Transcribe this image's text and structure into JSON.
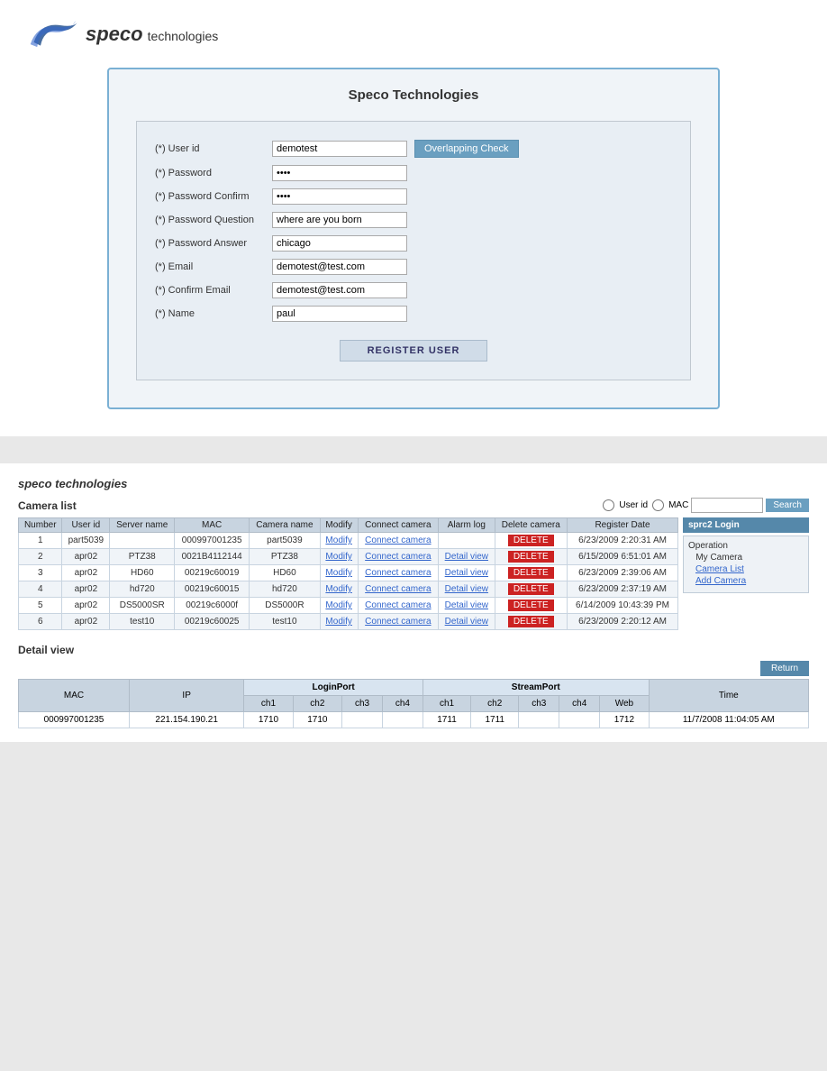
{
  "page": {
    "background": "#e8e8e8"
  },
  "top": {
    "logo": {
      "brand": "speco",
      "suffix": "technologies"
    },
    "form": {
      "title": "Speco Technologies",
      "fields": {
        "user_id_label": "(*) User id",
        "user_id_value": "demotest",
        "password_label": "(*) Password",
        "password_confirm_label": "(*) Password Confirm",
        "password_question_label": "(*) Password Question",
        "password_question_value": "where are you born",
        "password_answer_label": "(*) Password Answer",
        "password_answer_value": "chicago",
        "email_label": "(*) Email",
        "email_value": "demotest@test.com",
        "confirm_email_label": "(*) Confirm Email",
        "confirm_email_value": "demotest@test.com",
        "name_label": "(*) Name",
        "name_value": "paul"
      },
      "overlap_btn": "Overlapping Check",
      "register_btn": "REGISTER USER"
    }
  },
  "bottom": {
    "camera_list": {
      "title": "Camera list",
      "search": {
        "user_id_label": "User id",
        "mac_label": "MAC",
        "placeholder": "",
        "btn": "Search"
      },
      "columns": [
        "Number",
        "User id",
        "Server name",
        "MAC",
        "Camera name",
        "Modify",
        "Connect camera",
        "Alarm log",
        "Delete camera",
        "Register Date"
      ],
      "rows": [
        {
          "num": "1",
          "user_id": "part5039",
          "server": "",
          "mac": "000997001235",
          "cam_name": "part5039",
          "modify": "Modify",
          "connect": "Connect camera",
          "alarm": "",
          "delete": "DELETE",
          "date": "6/23/2009 2:20:31 AM"
        },
        {
          "num": "2",
          "user_id": "apr02",
          "server": "PTZ38",
          "mac": "0021B4112144",
          "cam_name": "PTZ38",
          "modify": "Modify",
          "connect": "Connect camera",
          "alarm": "Detail view",
          "delete": "DELETE",
          "date": "6/15/2009 6:51:01 AM"
        },
        {
          "num": "3",
          "user_id": "apr02",
          "server": "HD60",
          "mac": "00219c60019",
          "cam_name": "HD60",
          "modify": "Modify",
          "connect": "Connect camera",
          "alarm": "Detail view",
          "delete": "DELETE",
          "date": "6/23/2009 2:39:06 AM"
        },
        {
          "num": "4",
          "user_id": "apr02",
          "server": "hd720",
          "mac": "00219c60015",
          "cam_name": "hd720",
          "modify": "Modify",
          "connect": "Connect camera",
          "alarm": "Detail view",
          "delete": "DELETE",
          "date": "6/23/2009 2:37:19 AM"
        },
        {
          "num": "5",
          "user_id": "apr02",
          "server": "DS5000SR",
          "mac": "00219c6000f",
          "cam_name": "DS5000R",
          "modify": "Modify",
          "connect": "Connect camera",
          "alarm": "Detail view",
          "delete": "DELETE",
          "date": "6/14/2009 10:43:39 PM"
        },
        {
          "num": "6",
          "user_id": "apr02",
          "server": "test10",
          "mac": "00219c60025",
          "cam_name": "test10",
          "modify": "Modify",
          "connect": "Connect camera",
          "alarm": "Detail view",
          "delete": "DELETE",
          "date": "6/23/2009 2:20:12 AM"
        }
      ]
    },
    "right_panel": {
      "login_title": "sprc2 Login",
      "operation_label": "Operation",
      "my_camera_label": "My Camera",
      "camera_list_label": "Camera List",
      "add_camera_label": "Add Camera"
    },
    "detail_view": {
      "title": "Detail view",
      "return_btn": "Return",
      "login_port_label": "LoginPort",
      "stream_port_label": "StreamPort",
      "columns": [
        "MAC",
        "IP",
        "ch1",
        "ch2",
        "ch3",
        "ch4",
        "ch1",
        "ch2",
        "ch3",
        "ch4",
        "Web",
        "Time"
      ],
      "row": {
        "mac": "000997001235",
        "ip": "221.154.190.21",
        "login_ch1": "1710",
        "login_ch2": "1710",
        "login_ch3": "",
        "login_ch4": "",
        "stream_ch1": "1711",
        "stream_ch2": "1711",
        "stream_ch3": "",
        "stream_ch4": "",
        "web": "1712",
        "time": "11/7/2008 11:04:05 AM"
      }
    }
  }
}
